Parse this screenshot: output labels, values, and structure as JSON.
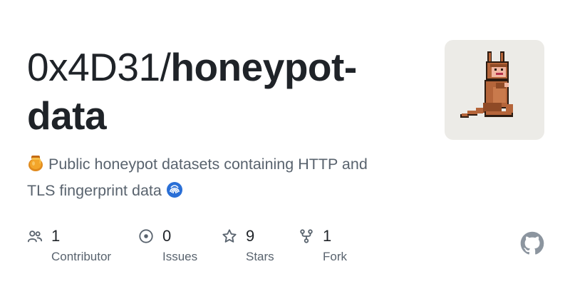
{
  "repo": {
    "owner": "0x4D31/",
    "name": "honeypot-data",
    "name_line1": "honeypot-",
    "name_line2": "data"
  },
  "description": {
    "lead_emoji": "honey-pot-emoji",
    "text_line1": "Public honeypot datasets containing HTTP and",
    "text_line2": "TLS fingerprint data",
    "trail_emoji": "fingerprint-emoji"
  },
  "stats": [
    {
      "icon": "people-icon",
      "count": "1",
      "label": "Contributor"
    },
    {
      "icon": "issue-opened-icon",
      "count": "0",
      "label": "Issues"
    },
    {
      "icon": "star-icon",
      "count": "9",
      "label": "Stars"
    },
    {
      "icon": "repo-forked-icon",
      "count": "1",
      "label": "Fork"
    }
  ],
  "avatar": {
    "icon": "kangaroo-pixel-art"
  },
  "brand_icon": "github-mark-icon",
  "colors": {
    "title": "#1f2328",
    "muted": "#59636e",
    "avatar_bg": "#ecebe7",
    "kangaroo": "#b5653a"
  }
}
